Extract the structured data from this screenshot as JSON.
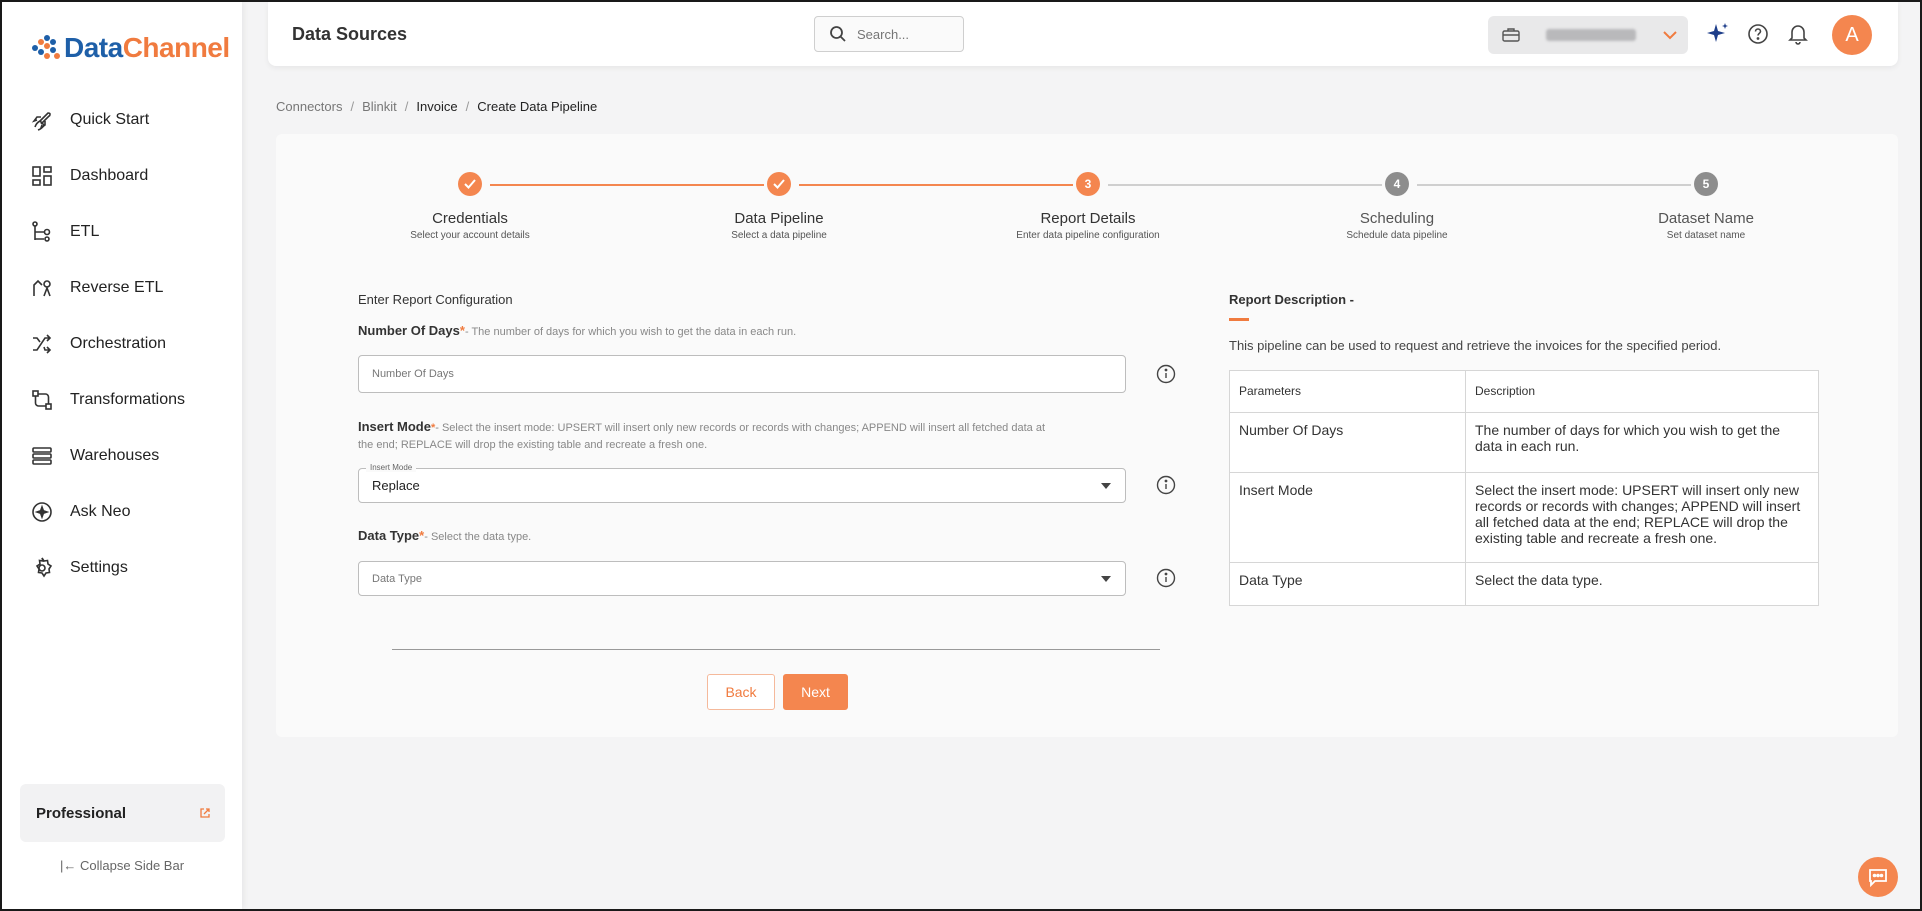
{
  "brand": {
    "name_part1": "Data",
    "name_part2": "Channel",
    "colors": {
      "accent": "#f07b3f",
      "blue": "#1e5fa8"
    }
  },
  "sidebar": {
    "items": [
      {
        "label": "Quick Start",
        "icon": "rocket-icon"
      },
      {
        "label": "Dashboard",
        "icon": "dashboard-icon"
      },
      {
        "label": "ETL",
        "icon": "etl-icon"
      },
      {
        "label": "Reverse ETL",
        "icon": "reverse-etl-icon"
      },
      {
        "label": "Orchestration",
        "icon": "orchestration-icon"
      },
      {
        "label": "Transformations",
        "icon": "transformations-icon"
      },
      {
        "label": "Warehouses",
        "icon": "warehouses-icon"
      },
      {
        "label": "Ask Neo",
        "icon": "ask-neo-icon"
      },
      {
        "label": "Settings",
        "icon": "settings-icon"
      }
    ],
    "plan_label": "Professional",
    "collapse_label": "Collapse Side Bar"
  },
  "header": {
    "title": "Data Sources",
    "search_placeholder": "Search...",
    "avatar_initial": "A"
  },
  "breadcrumb": {
    "items": [
      "Connectors",
      "Blinkit",
      "Invoice",
      "Create Data Pipeline"
    ],
    "separator": "/"
  },
  "stepper": {
    "steps": [
      {
        "title": "Credentials",
        "subtitle": "Select your account details",
        "state": "done",
        "number": "1"
      },
      {
        "title": "Data Pipeline",
        "subtitle": "Select a data pipeline",
        "state": "done",
        "number": "2"
      },
      {
        "title": "Report Details",
        "subtitle": "Enter data pipeline configuration",
        "state": "active",
        "number": "3"
      },
      {
        "title": "Scheduling",
        "subtitle": "Schedule data pipeline",
        "state": "pending",
        "number": "4"
      },
      {
        "title": "Dataset Name",
        "subtitle": "Set dataset name",
        "state": "pending",
        "number": "5"
      }
    ]
  },
  "form": {
    "section_title": "Enter Report Configuration",
    "required_mark": "*",
    "days": {
      "label": "Number Of Days",
      "hint": "- The number of days for which you wish to get the data in each run.",
      "placeholder": "Number Of Days"
    },
    "insert_mode": {
      "label": "Insert Mode",
      "hint": "- Select the insert mode: UPSERT will insert only new records or records with changes; APPEND will insert all fetched data at the end; REPLACE will drop the existing table and recreate a fresh one.",
      "floating_label": "Insert Mode",
      "value": "Replace"
    },
    "data_type": {
      "label": "Data Type",
      "hint": "- Select the data type.",
      "placeholder": "Data Type"
    },
    "back_label": "Back",
    "next_label": "Next"
  },
  "report_description": {
    "title": "Report Description -",
    "text": "This pipeline can be used to request and retrieve the invoices for the specified period.",
    "table": {
      "headers": [
        "Parameters",
        "Description"
      ],
      "rows": [
        [
          "Number Of Days",
          "The number of days for which you wish to get the data in each run."
        ],
        [
          "Insert Mode",
          "Select the insert mode: UPSERT will insert only new records or records with changes; APPEND will insert all fetched data at the end; REPLACE will drop the existing table and recreate a fresh one."
        ],
        [
          "Data Type",
          "Select the data type."
        ]
      ]
    }
  }
}
